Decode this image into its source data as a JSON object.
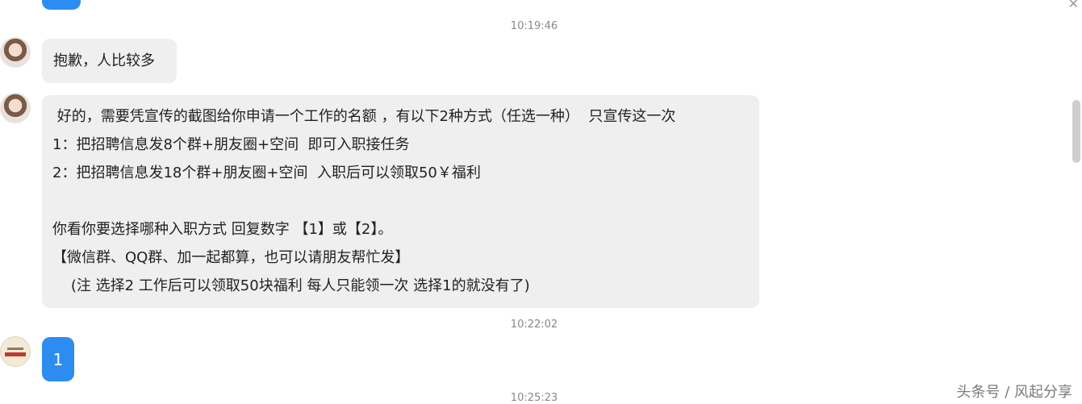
{
  "messages": {
    "timestamps": [
      "10:19:46",
      "10:22:02",
      "10:25:23"
    ],
    "reply_short": "抱歉，人比较多",
    "reply_long_lines": [
      " 好的，需要凭宣传的截图给你申请一个工作的名额 ，有以下2种方式（任选一种）  只宣传这一次",
      "1：把招聘信息发8个群+朋友圈+空间  即可入职接任务",
      "2：把招聘信息发18个群+朋友圈+空间  入职后可以领取50￥福利",
      "",
      "你看你要选择哪种入职方式 回复数字 【1】或【2】。",
      "【微信群、QQ群、加一起都算，也可以请朋友帮忙发】",
      "    (注 选择2 工作后可以领取50块福利 每人只能领一次 选择1的就没有了)"
    ],
    "user_reply": "1"
  },
  "watermark": "头条号 / 风起分享",
  "icons": {
    "close": "close-icon"
  },
  "colors": {
    "sent_bubble": "#2d8cf0",
    "received_bubble": "#efefef"
  }
}
